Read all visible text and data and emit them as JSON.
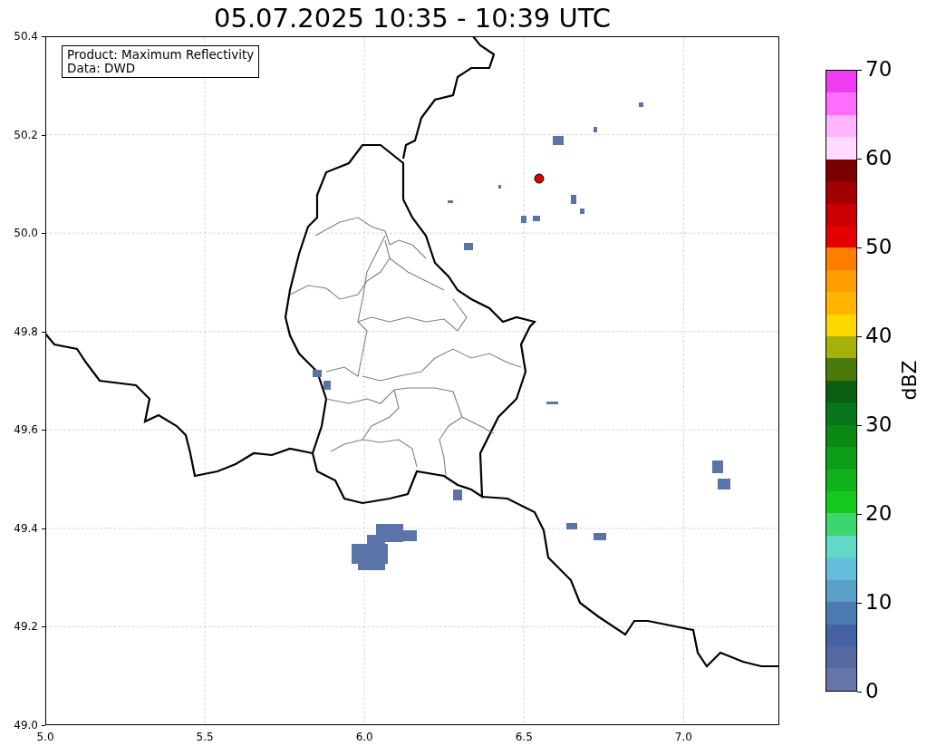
{
  "title": "05.07.2025 10:35 - 10:39 UTC",
  "info_box": {
    "lines": [
      "Product: Maximum Reflectivity",
      "Data: DWD"
    ]
  },
  "map": {
    "yticks": [
      "50.4",
      "50.2",
      "50.0",
      "49.8",
      "49.6",
      "49.4",
      "49.2",
      "49.0"
    ],
    "xticks": [
      "5.0",
      "5.5",
      "6.0",
      "6.5",
      "7.0"
    ]
  },
  "colorbar": {
    "label": "dBZ",
    "ticks": [
      "70",
      "60",
      "50",
      "40",
      "30",
      "20",
      "10",
      "0"
    ],
    "bins": [
      {
        "color": "#f03cf0"
      },
      {
        "color": "#ff6eff"
      },
      {
        "color": "#ffb4ff"
      },
      {
        "color": "#ffdcff"
      },
      {
        "color": "#7a0000"
      },
      {
        "color": "#a00000"
      },
      {
        "color": "#c80000"
      },
      {
        "color": "#e40000"
      },
      {
        "color": "#ff7e00"
      },
      {
        "color": "#ff9c00"
      },
      {
        "color": "#ffb400"
      },
      {
        "color": "#ffd800"
      },
      {
        "color": "#a8b00a"
      },
      {
        "color": "#4a7a0c"
      },
      {
        "color": "#0a5e10"
      },
      {
        "color": "#08761a"
      },
      {
        "color": "#0a8a14"
      },
      {
        "color": "#0c9e18"
      },
      {
        "color": "#10b41a"
      },
      {
        "color": "#14c81e"
      },
      {
        "color": "#3ed46e"
      },
      {
        "color": "#62d8c6"
      },
      {
        "color": "#63bedb"
      },
      {
        "color": "#5a9fc8"
      },
      {
        "color": "#4a7ab0"
      },
      {
        "color": "#4560a4"
      },
      {
        "color": "#5569a0"
      },
      {
        "color": "#6577a8"
      }
    ]
  }
}
